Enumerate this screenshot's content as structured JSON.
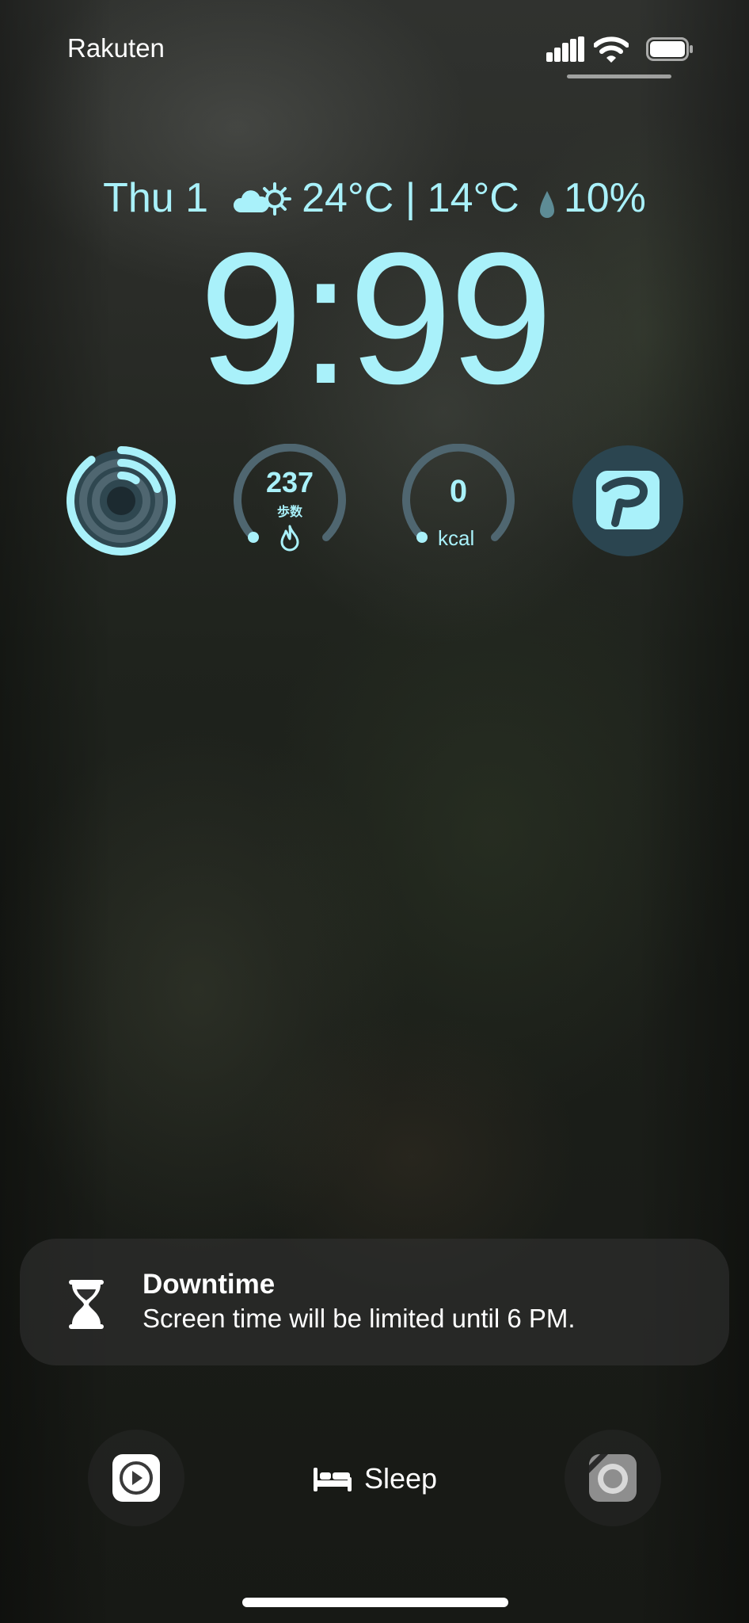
{
  "status_bar": {
    "carrier": "Rakuten",
    "icons": [
      "cellular-signal-icon",
      "wifi-icon",
      "battery-icon"
    ]
  },
  "lock_screen": {
    "date": "Thu 1",
    "weather_icon": "partly-sunny-icon",
    "temperature_range": "24°C | 14°C",
    "precip_icon": "raindrop-icon",
    "precipitation": "10%",
    "time": "9:99"
  },
  "widgets": {
    "activity": {
      "icon": "activity-rings-icon",
      "move_progress": 0.9,
      "exercise_progress": 0.2,
      "stand_progress": 0.1
    },
    "steps": {
      "value": "237",
      "unit": "歩数",
      "icon": "flame-icon"
    },
    "calories": {
      "value": "0",
      "unit": "kcal",
      "progress": 0
    },
    "paypay": {
      "icon": "paypay-icon"
    }
  },
  "notification": {
    "icon": "hourglass-icon",
    "title": "Downtime",
    "body": "Screen time will be limited until 6 PM."
  },
  "bottom_bar": {
    "left_shortcut_icon": "video-player-icon",
    "sleep_icon": "bed-icon",
    "sleep_label": "Sleep",
    "right_shortcut_icon": "camera-pro-icon"
  },
  "colors": {
    "accent": "#a9f1fa",
    "widget_ring_track": "#4f6670",
    "notification_bg": "#303030"
  }
}
